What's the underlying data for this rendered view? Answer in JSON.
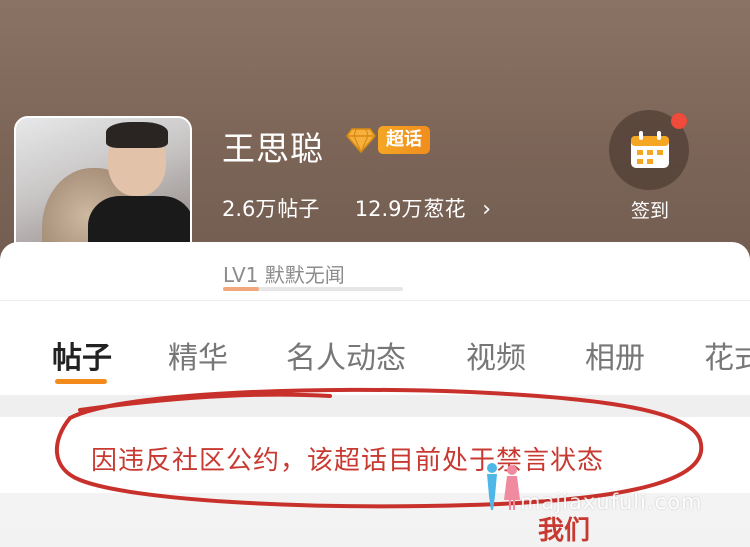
{
  "header": {
    "title": "王思聪",
    "badge": "超话",
    "stats": {
      "posts_num": "2.6万",
      "posts_label": "帖子",
      "fans_num": "12.9万",
      "fans_label": "葱花"
    },
    "checkin_label": "签到",
    "level_label": "LV1 默默无闻",
    "level_progress": 0.2
  },
  "tabs": [
    "帖子",
    "精华",
    "名人动态",
    "视频",
    "相册",
    "花式"
  ],
  "active_tab": "帖子",
  "notice": "因违反社区公约，该超话目前处于禁言状态",
  "partial_text": "我们",
  "watermark": "majiaxufuli.com",
  "colors": {
    "accent": "#f28a1c",
    "notice_red": "#c83a31",
    "badge_orange": "#f5a623",
    "header_brown": "#7d6658"
  },
  "icons": [
    "diamond-icon",
    "chevron-right-icon",
    "calendar-icon"
  ]
}
